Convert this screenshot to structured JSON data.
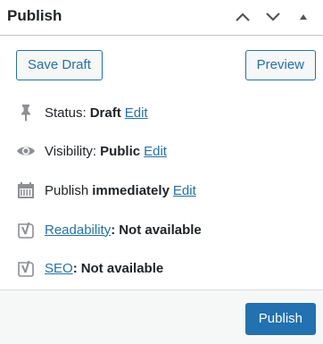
{
  "header": {
    "title": "Publish",
    "move_up_icon": "chevron-up-icon",
    "move_down_icon": "chevron-down-icon",
    "toggle_icon": "triangle-up-icon"
  },
  "actions": {
    "save_draft_label": "Save Draft",
    "preview_label": "Preview"
  },
  "status": {
    "label": "Status:",
    "value": "Draft",
    "edit_label": "Edit",
    "icon": "pin-icon"
  },
  "visibility": {
    "label": "Visibility:",
    "value": "Public",
    "edit_label": "Edit",
    "icon": "eye-icon"
  },
  "schedule": {
    "label": "Publish",
    "value": "immediately",
    "edit_label": "Edit",
    "icon": "calendar-icon"
  },
  "readability": {
    "link_label": "Readability",
    "separator": ":",
    "value": "Not available",
    "icon": "yoast-icon"
  },
  "seo": {
    "link_label": "SEO",
    "separator": ":",
    "value": "Not available",
    "icon": "yoast-icon"
  },
  "footer": {
    "publish_label": "Publish"
  },
  "colors": {
    "accent": "#2271b1",
    "text": "#1d2327",
    "icon": "#8c8f94",
    "footer_bg": "#f6f7f7",
    "border": "#c3c4c7"
  }
}
